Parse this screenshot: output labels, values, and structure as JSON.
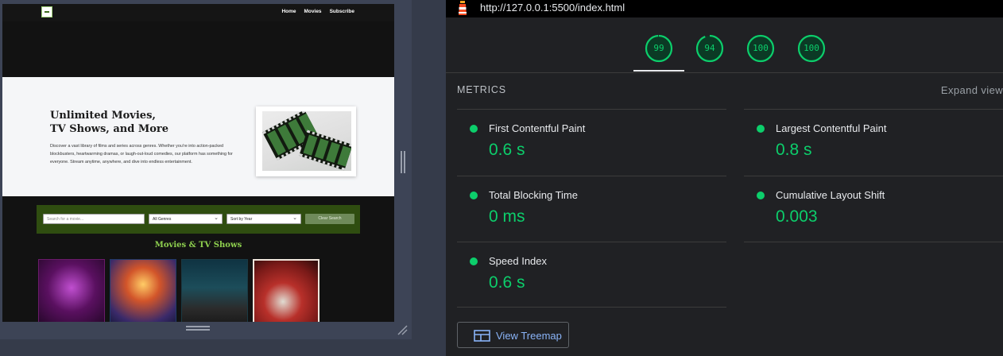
{
  "preview": {
    "nav": {
      "links": [
        "Home",
        "Movies",
        "Subscribe"
      ]
    },
    "hero": {
      "title_line1": "Unlimited Movies,",
      "title_line2": "TV Shows, and More",
      "description": "Discover a vast library of films and series across genres. Whether you're into action-packed blockbusters, heartwarming dramas, or laugh-out-loud comedies, our platform has something for everyone. Stream anytime, anywhere, and dive into endless entertainment."
    },
    "search": {
      "placeholder": "Search for a movie...",
      "genre_selected": "All Genres",
      "sort_selected": "Sort by Year",
      "clear_label": "Clear Search"
    },
    "section_title": "Movies & TV Shows",
    "posters": [
      "poster-1",
      "poster-2",
      "poster-3",
      "poster-4"
    ]
  },
  "panel": {
    "url": "http://127.0.0.1:5500/index.html",
    "scores": [
      {
        "value": "99",
        "score": 99
      },
      {
        "value": "94",
        "score": 94
      },
      {
        "value": "100",
        "score": 100
      },
      {
        "value": "100",
        "score": 100
      }
    ],
    "metrics_heading": "METRICS",
    "expand_view": "Expand view",
    "metrics": [
      {
        "label": "First Contentful Paint",
        "value": "0.6 s"
      },
      {
        "label": "Largest Contentful Paint",
        "value": "0.8 s"
      },
      {
        "label": "Total Blocking Time",
        "value": "0 ms"
      },
      {
        "label": "Cumulative Layout Shift",
        "value": "0.003"
      },
      {
        "label": "Speed Index",
        "value": "0.6 s"
      }
    ],
    "treemap_label": "View Treemap",
    "colors": {
      "pass": "#0cce6b",
      "link": "#8ab4f8",
      "background": "#202124"
    }
  }
}
